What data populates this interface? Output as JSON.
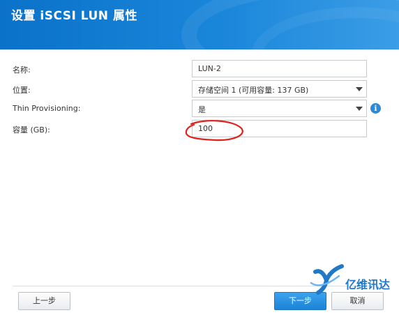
{
  "dialog": {
    "title": "设置 iSCSI LUN 属性"
  },
  "form": {
    "name": {
      "label": "名称:",
      "value": "LUN-2"
    },
    "location": {
      "label": "位置:",
      "value": "存储空间 1 (可用容量: 137 GB)"
    },
    "thin_provisioning": {
      "label": "Thin Provisioning:",
      "value": "是"
    },
    "capacity": {
      "label": "容量 (GB):",
      "value": "100"
    }
  },
  "footer": {
    "back_label": "上一步",
    "next_label": "下一步",
    "cancel_label": "取消"
  },
  "watermark": {
    "text": "亿维讯达"
  },
  "colors": {
    "header": "#1a86da",
    "primary_button": "#1c83d6",
    "annotation": "#e0201a"
  }
}
